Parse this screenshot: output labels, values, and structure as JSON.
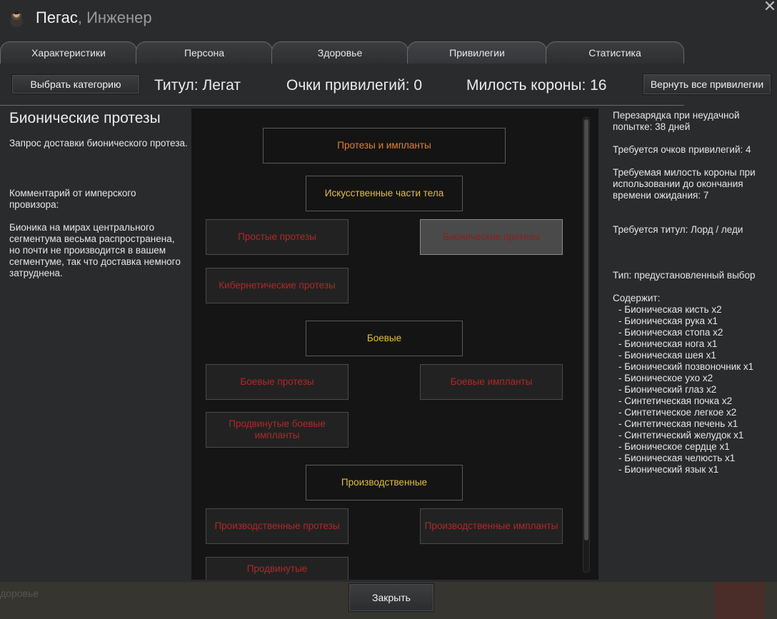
{
  "window": {
    "name": "Пегас",
    "separator": ", ",
    "role": "Инженер",
    "close_glyph": "✕"
  },
  "tabs": [
    {
      "label": "Характеристики",
      "active": false
    },
    {
      "label": "Персона",
      "active": false
    },
    {
      "label": "Здоровье",
      "active": false
    },
    {
      "label": "Привилегии",
      "active": true
    },
    {
      "label": "Статистика",
      "active": false
    }
  ],
  "topbar": {
    "select_category_label": "Выбрать категорию",
    "title_stat": "Титул: Легат",
    "points_stat": "Очки привилегий: 0",
    "favor_stat": "Милость короны: 16",
    "return_all_label": "Вернуть все привилегии"
  },
  "left": {
    "heading": "Бионические протезы",
    "description": "Запрос доставки бионического протеза.",
    "comment_label": "Комментарий от имперского провизора:",
    "comment": "Бионика на мирах центрального сегментума весьма распространена, но почти не производится в вашем сегментуме, так что доставка немного затруднена."
  },
  "tree": {
    "root": "Протезы и импланты",
    "artificial": "Искусственные части тела",
    "simple": "Простые протезы",
    "bionic": "Бионические протезы",
    "cybernetic": "Кибернетические протезы",
    "combat": "Боевые",
    "combat_prosthetics": "Боевые протезы",
    "combat_implants": "Боевые импланты",
    "advanced_combat": "Продвинутые боевые импланты",
    "industrial": "Производственные",
    "industrial_prosthetics": "Производственные протезы",
    "industrial_implants": "Производственные импланты",
    "advanced_partial": "Продвинутые"
  },
  "right": {
    "cooldown": "Перезарядка при неудачной попытке: 38 дней",
    "points_required": "Требуется очков привилегий: 4",
    "favor_required": "Требуемая милость короны при использовании до окончания времени ожидания: 7",
    "title_required": "Требуется титул: Лорд / леди",
    "type": "Тип: предустановленный выбор",
    "contains_label": "Содержит:",
    "contents": [
      "- Бионическая кисть x2",
      "- Бионическая рука x1",
      "- Бионическая стопа x2",
      "- Бионическая нога x1",
      "- Бионическая шея x1",
      "- Бионический позвоночник x1",
      "- Бионическое ухо x2",
      "- Бионический глаз x2",
      "- Синтетическая почка x2",
      "- Синтетическое легкое x2",
      "- Синтетическая печень x1",
      "- Синтетический желудок x1",
      "- Бионическое сердце x1",
      "- Бионическая челюсть x1",
      "- Бионический язык x1"
    ]
  },
  "footer": {
    "close_label": "Закрыть",
    "background_text": "доровье"
  },
  "colors": {
    "node_orange": "#e0822a",
    "node_yellow": "#e4bf3a",
    "node_red": "#b02828"
  }
}
